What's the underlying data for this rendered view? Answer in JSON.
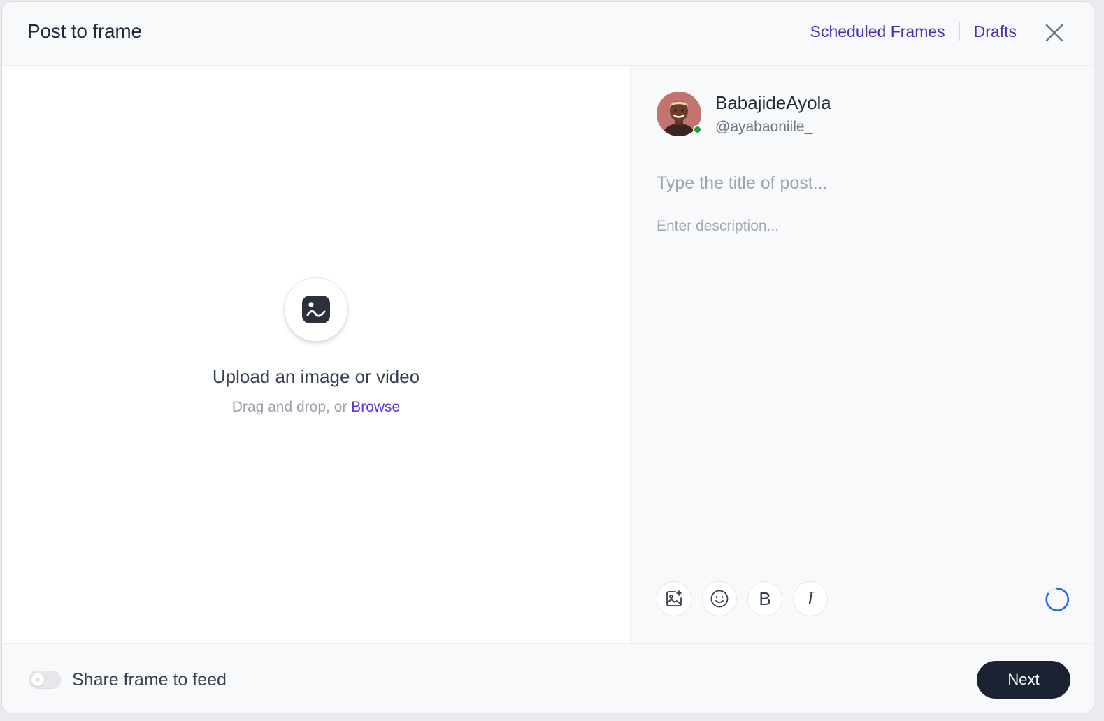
{
  "header": {
    "title": "Post to frame",
    "links": [
      "Scheduled Frames",
      "Drafts"
    ],
    "close_icon": "close-icon"
  },
  "upload": {
    "icon": "image-icon",
    "title": "Upload an image or video",
    "subtitle_prefix": "Drag and drop, or ",
    "browse_label": "Browse"
  },
  "user": {
    "name": "BabajideAyola",
    "handle": "@ayabaoniile_",
    "status": "online",
    "status_color": "#1f9d3a"
  },
  "composer": {
    "title_placeholder": "Type the title of post...",
    "description_placeholder": "Enter description...",
    "toolbar": [
      {
        "icon": "add-image-icon"
      },
      {
        "icon": "emoji-icon"
      },
      {
        "icon": "bold-icon",
        "label": "B"
      },
      {
        "icon": "italic-icon",
        "label": "I"
      }
    ],
    "progress_icon": "character-count-ring-icon"
  },
  "footer": {
    "toggle_label": "Share frame to feed",
    "toggle_on": false,
    "next_label": "Next"
  },
  "colors": {
    "accent_link": "#4c2bb4",
    "browse_link": "#5b35d5",
    "primary_button": "#1b2333",
    "spinner": "#2563eb"
  }
}
